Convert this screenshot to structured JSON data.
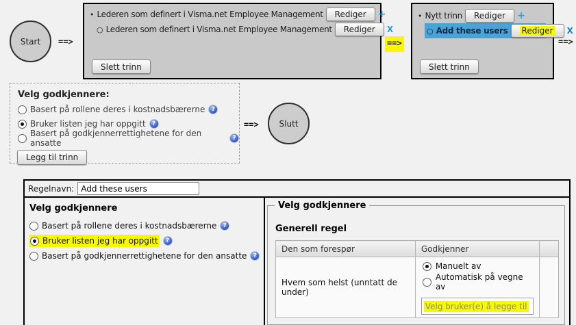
{
  "icons": {
    "bullet": "•",
    "subbullet": "○",
    "plus": "+",
    "remove": "X",
    "help": "?"
  },
  "flow": {
    "arrow": "==>",
    "start_label": "Start",
    "end_label": "Slutt",
    "steps": [
      {
        "rows": [
          {
            "text": "Lederen som definert i Visma.net Employee Management",
            "button": "Rediger"
          },
          {
            "text": "Lederen som definert i Visma.net Employee Management",
            "button": "Rediger"
          }
        ],
        "delete_button": "Slett trinn"
      },
      {
        "rows": [
          {
            "text": "Nytt trinn",
            "button": "Rediger"
          },
          {
            "text": "Add these users",
            "button": "Rediger",
            "highlighted": true
          }
        ],
        "delete_button": "Slett trinn"
      }
    ]
  },
  "chooser": {
    "title": "Velg godkjennere:",
    "options": [
      {
        "label": "Basert på rollene deres i kostnadsbærerne",
        "selected": false
      },
      {
        "label": "Bruker listen jeg har oppgitt",
        "selected": true
      },
      {
        "label": "Basert på godkjennerrettighetene for den ansatte",
        "selected": false
      }
    ],
    "add_button": "Legg til trinn"
  },
  "editor": {
    "rule_name_label": "Regelnavn:",
    "rule_name_value": "Add these users",
    "approvers": {
      "title": "Velg godkjennere",
      "options": [
        {
          "label": "Basert på rollene deres i kostnadsbærerne",
          "selected": false
        },
        {
          "label": "Bruker listen jeg har oppgitt",
          "selected": true,
          "highlighted": true
        },
        {
          "label": "Basert på godkjennerrettighetene for den ansatte",
          "selected": false
        }
      ]
    },
    "rule_panel": {
      "legend": "Velg godkjennere",
      "heading": "Generell regel",
      "col_requester": "Den som forespør",
      "col_approver": "Godkjenner",
      "requester_value": "Hvem som helst (unntatt de under)",
      "approve_options": [
        {
          "label": "Manuelt av",
          "selected": true
        },
        {
          "label": "Automatisk på vegne av",
          "selected": false
        }
      ],
      "picker_text": "Velg bruker(e) å legge til"
    }
  },
  "colors": {
    "highlight_yellow": "#f8f800",
    "highlight_blue": "#4aa3d8",
    "link_blue": "#2b9fd9",
    "step_box_gray": "#c9c9c9"
  }
}
